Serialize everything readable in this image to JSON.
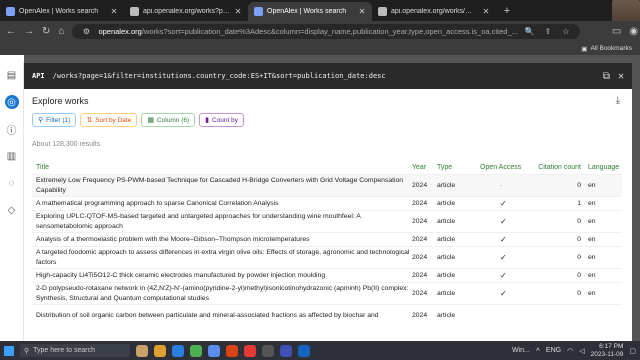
{
  "browser": {
    "tabs": [
      {
        "title": "OpenAlex | Works search",
        "active": false
      },
      {
        "title": "api.openalex.org/works?page=1",
        "active": false
      },
      {
        "title": "OpenAlex | Works search",
        "active": true
      },
      {
        "title": "api.openalex.org/works/W210...",
        "active": false
      }
    ],
    "url_host": "openalex.org",
    "url_path": "/works?sort=publication_date%3Adesc&column=display_name,publication_year,type,open_access.is_oa,cited_...",
    "bookmarks_label": "All Bookmarks"
  },
  "api": {
    "label": "API",
    "url": "/works?page=1&filter=institutions.country_code:ES+IT&sort=publication_date:desc"
  },
  "panel": {
    "title": "Explore works",
    "results": "About 128,300 results",
    "chips": {
      "filter": "Filter (1)",
      "sort": "Sort by Date",
      "column": "Column (6)",
      "countby": "Count by"
    }
  },
  "table": {
    "headers": {
      "title": "Title",
      "year": "Year",
      "type": "Type",
      "oa": "Open Access",
      "cites": "Citation count",
      "lang": "Language"
    },
    "rows": [
      {
        "title": "Extremely Low Frequency PS-PWM-based Technique for Cascaded H-Bridge Converters with Grid Voltage Compensation Capability",
        "year": "2024",
        "type": "article",
        "oa": "-",
        "cites": "0",
        "lang": "en"
      },
      {
        "title": "A mathematical programming approach to sparse Canonical Correlation Analysis",
        "year": "2024",
        "type": "article",
        "oa": "✓",
        "cites": "1",
        "lang": "en"
      },
      {
        "title": "Exploring UPLC-QTOF-MS-based targeted and untargeted approaches for understanding wine mouthfeel: A sensometabolomic approach",
        "year": "2024",
        "type": "article",
        "oa": "✓",
        "cites": "0",
        "lang": "en"
      },
      {
        "title": "Analysis of a thermoelastic problem with the Moore–Gibson–Thompson microtemperatures",
        "year": "2024",
        "type": "article",
        "oa": "✓",
        "cites": "0",
        "lang": "en"
      },
      {
        "title": "A targeted foodomic approach to assess differences in extra virgin olive oils: Effects of storage, agronomic and technological factors",
        "year": "2024",
        "type": "article",
        "oa": "✓",
        "cites": "0",
        "lang": "en"
      },
      {
        "title": "High-capacity Li4Ti5O12-C thick ceramic electrodes manufactured by powder injection moulding",
        "year": "2024",
        "type": "article",
        "oa": "✓",
        "cites": "0",
        "lang": "en"
      },
      {
        "title": "2-D polypseudo-rotaxane network in (4Z,N'Z)-N'-(amino(pyridine-2-yl)methyl)isonicotinohydrazonic (apminh) Pb(II) complex: Synthesis, Structural and Quantum computational studies",
        "year": "2024",
        "type": "article",
        "oa": "✓",
        "cites": "0",
        "lang": "en"
      },
      {
        "title": "Distribution of soil organic carbon between particulate and mineral-associated fractions as affected by biochar and",
        "year": "2024",
        "type": "article",
        "oa": "",
        "cites": "",
        "lang": ""
      }
    ]
  },
  "taskbar": {
    "search_placeholder": "Type here to search",
    "weather": "Win...",
    "lang": "ENG",
    "time": "6:17 PM",
    "date": "2023-11-09"
  }
}
